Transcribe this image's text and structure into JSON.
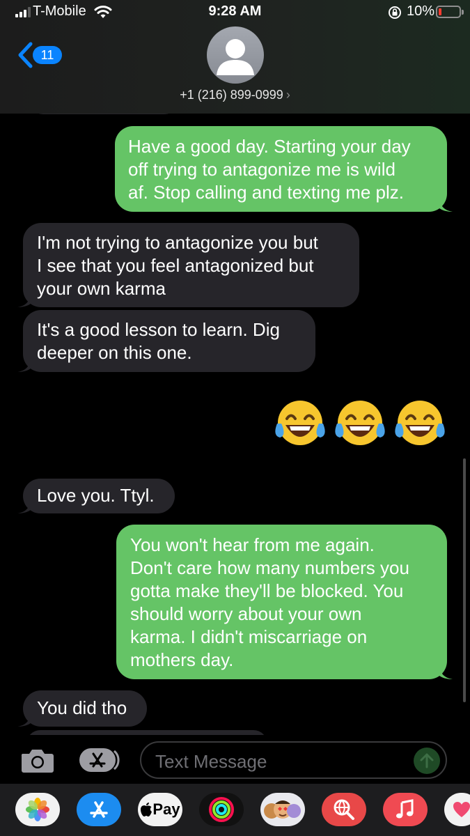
{
  "status_bar": {
    "carrier": "T-Mobile",
    "time": "9:28 AM",
    "battery_percent": "10%"
  },
  "header": {
    "back_count": "11",
    "contact": "+1 (216) 899-0999",
    "contact_chevron": "›"
  },
  "messages": [
    {
      "direction": "sent",
      "lines": [
        "Have a good day. Starting your day",
        "off trying to antagonize me is wild",
        "af. Stop calling and texting me plz."
      ]
    },
    {
      "direction": "received",
      "lines": [
        "I'm not trying to antagonize you but",
        "I see that you feel antagonized but",
        "your own karma"
      ]
    },
    {
      "direction": "received",
      "lines": [
        "It's a good lesson to learn. Dig",
        "deeper on this one."
      ]
    },
    {
      "direction": "sent",
      "emoji": "face-with-tears-of-joy",
      "count": 3
    },
    {
      "direction": "received",
      "lines": [
        "Love you. Ttyl."
      ]
    },
    {
      "direction": "sent",
      "lines": [
        "You won't hear from me again.",
        "Don't care how many numbers you",
        "gotta make they'll be blocked. You",
        "should worry about your own",
        "karma. I didn't miscarriage on",
        "mothers day."
      ]
    },
    {
      "direction": "received",
      "lines": [
        "You did tho"
      ]
    }
  ],
  "input": {
    "placeholder": "Text Message"
  },
  "app_drawer": {
    "apps": [
      "photos-icon",
      "app-store-icon",
      "apple-pay-icon",
      "activity-icon",
      "memoji-stickers-icon",
      "web-search-icon",
      "music-icon",
      "digital-touch-icon"
    ],
    "pay_label": "Pay"
  },
  "colors": {
    "sent_bubble": "#65c466",
    "received_bubble": "#26252a",
    "accent": "#0a84ff"
  }
}
